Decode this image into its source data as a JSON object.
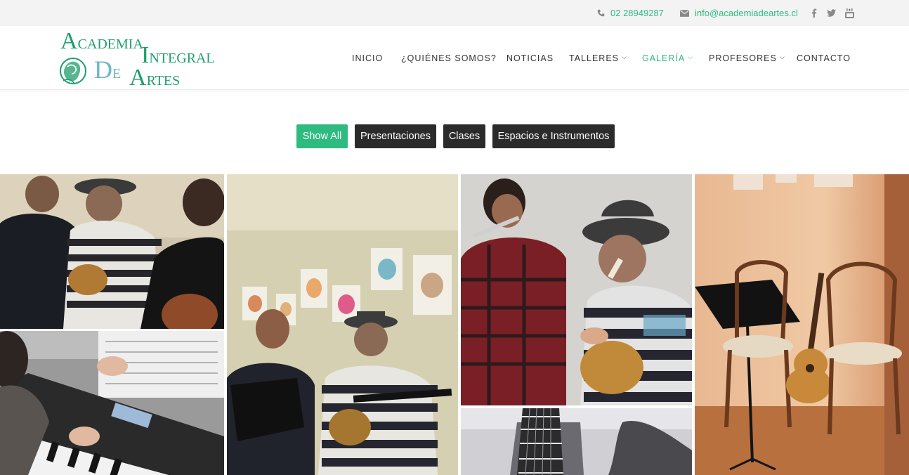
{
  "topbar": {
    "phone": "02 28949287",
    "email": "info@academiadeartes.cl",
    "social_icons": [
      "facebook-icon",
      "twitter-icon",
      "youtube-icon"
    ]
  },
  "logo": {
    "line1_big": "A",
    "line1_small": "CADEMIA",
    "line1b_big": "I",
    "line1b_small": "NTEGRAL",
    "line2_big": "D",
    "line2_small": "E",
    "line2b_big": "A",
    "line2b_small": "RTES"
  },
  "nav": {
    "items": [
      {
        "label": "INICIO"
      },
      {
        "label": "¿QUIÉNES SOMOS?"
      },
      {
        "label": "NOTICIAS"
      },
      {
        "label": "TALLERES"
      },
      {
        "label": "GALERÍA"
      },
      {
        "label": "PROFESORES"
      },
      {
        "label": "CONTACTO"
      }
    ],
    "active": "GALERÍA"
  },
  "filters": [
    {
      "label": "Show All",
      "active": true
    },
    {
      "label": "Presentaciones",
      "active": false
    },
    {
      "label": "Clases",
      "active": false
    },
    {
      "label": "Espacios e Instrumentos",
      "active": false
    }
  ],
  "colors": {
    "accent": "#2dbb80",
    "dark_button": "#2b2b2b",
    "topbar_bg": "#f3f3f3",
    "logo_green": "#1f9e6c",
    "logo_light": "#6fb7c7"
  }
}
